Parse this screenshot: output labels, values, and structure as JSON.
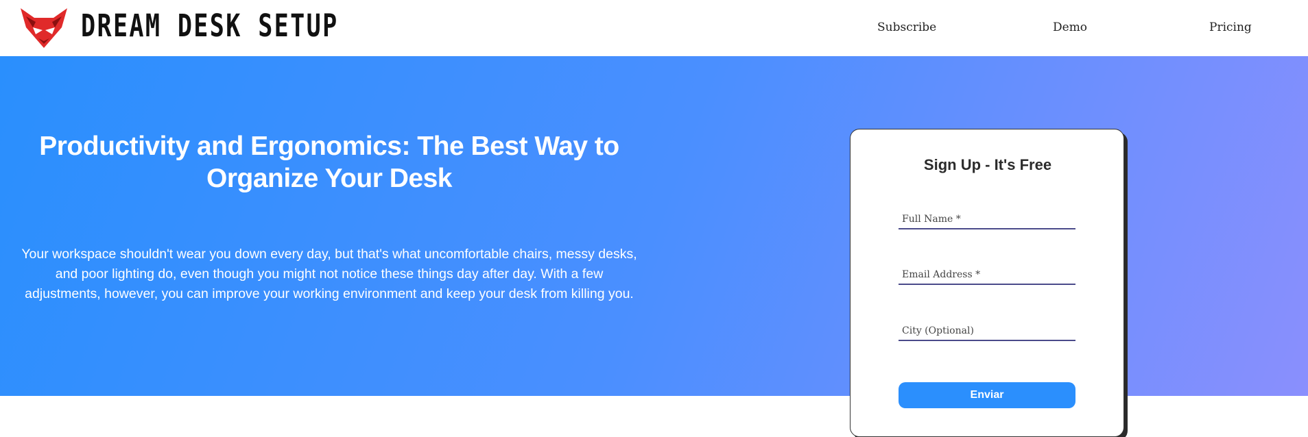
{
  "header": {
    "logo_icon": "fox-head-icon",
    "brand": "DREAM DESK SETUP",
    "nav": [
      {
        "label": "Subscribe"
      },
      {
        "label": "Demo"
      },
      {
        "label": "Pricing"
      }
    ]
  },
  "hero": {
    "title": "Productivity and Ergonomics: The Best Way to Organize Your Desk",
    "body": "Your workspace shouldn't wear you down every day, but that's what uncomfortable chairs, messy desks, and poor lighting do, even though you might not notice these things day after day. With a few adjustments, however, you can improve your working environment and keep your desk from killing you.",
    "gradient_colors": [
      "#2a8ffd",
      "#8a8ffd"
    ]
  },
  "signup": {
    "title": "Sign Up - It's Free",
    "fields": [
      {
        "placeholder": "Full Name *",
        "value": ""
      },
      {
        "placeholder": "Email Address *",
        "value": ""
      },
      {
        "placeholder": "City (Optional)",
        "value": ""
      }
    ],
    "submit_label": "Enviar",
    "accent_color": "#2b8ffd"
  }
}
